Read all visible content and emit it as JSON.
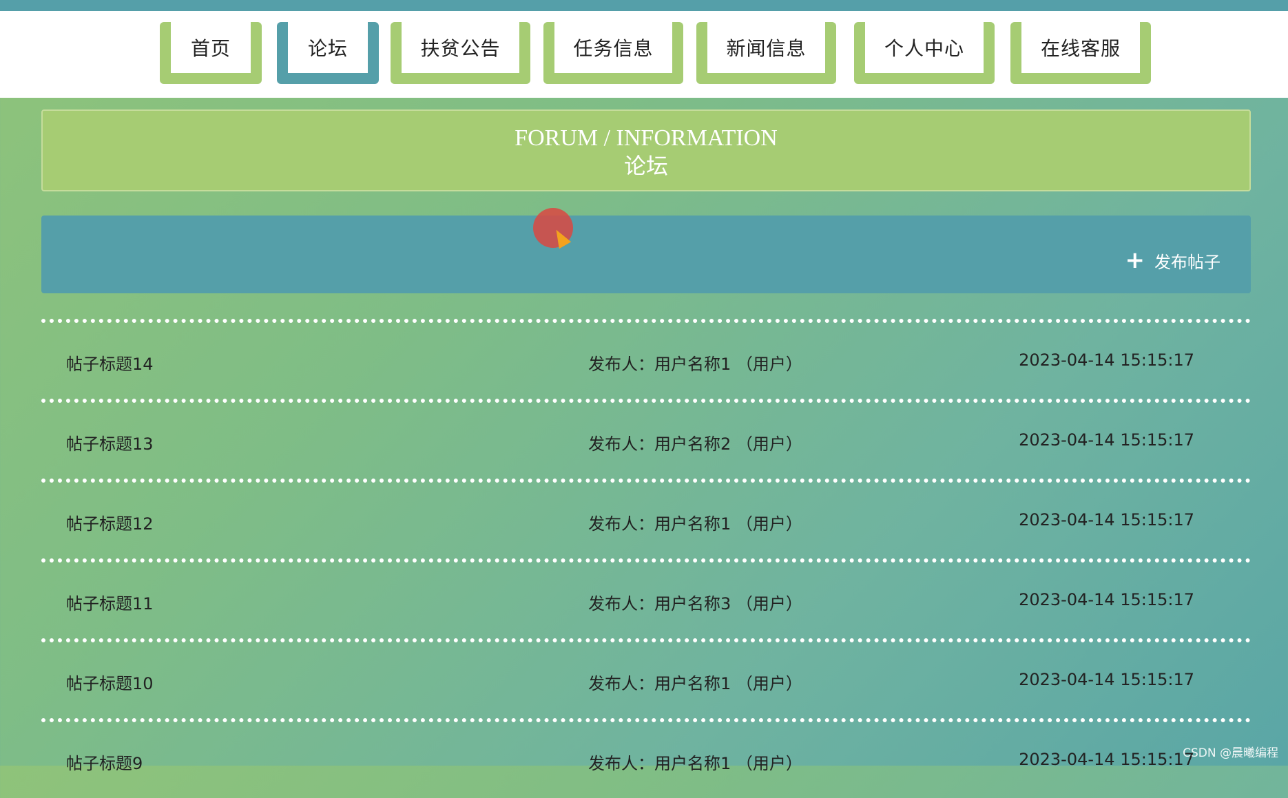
{
  "nav": {
    "items": [
      {
        "label": "首页",
        "active": false
      },
      {
        "label": "论坛",
        "active": true
      },
      {
        "label": "扶贫公告",
        "active": false
      },
      {
        "label": "任务信息",
        "active": false
      },
      {
        "label": "新闻信息",
        "active": false
      },
      {
        "label": "个人中心",
        "active": false
      },
      {
        "label": "在线客服",
        "active": false
      }
    ]
  },
  "header": {
    "title_en": "FORUM / INFORMATION",
    "title_cn": "论坛"
  },
  "toolbar": {
    "post_icon": "plus-icon",
    "post_label": "发布帖子"
  },
  "posts": [
    {
      "title": "帖子标题14",
      "author": "发布人：用户名称1 （用户）",
      "time": "2023-04-14 15:15:17"
    },
    {
      "title": "帖子标题13",
      "author": "发布人：用户名称2 （用户）",
      "time": "2023-04-14 15:15:17"
    },
    {
      "title": "帖子标题12",
      "author": "发布人：用户名称1 （用户）",
      "time": "2023-04-14 15:15:17"
    },
    {
      "title": "帖子标题11",
      "author": "发布人：用户名称3 （用户）",
      "time": "2023-04-14 15:15:17"
    },
    {
      "title": "帖子标题10",
      "author": "发布人：用户名称1 （用户）",
      "time": "2023-04-14 15:15:17"
    },
    {
      "title": "帖子标题9",
      "author": "发布人：用户名称1 （用户）",
      "time": "2023-04-14 15:15:17"
    }
  ],
  "watermark": "CSDN @晨曦编程",
  "colors": {
    "accent_green": "#a6cc73",
    "accent_teal": "#559fa9"
  }
}
